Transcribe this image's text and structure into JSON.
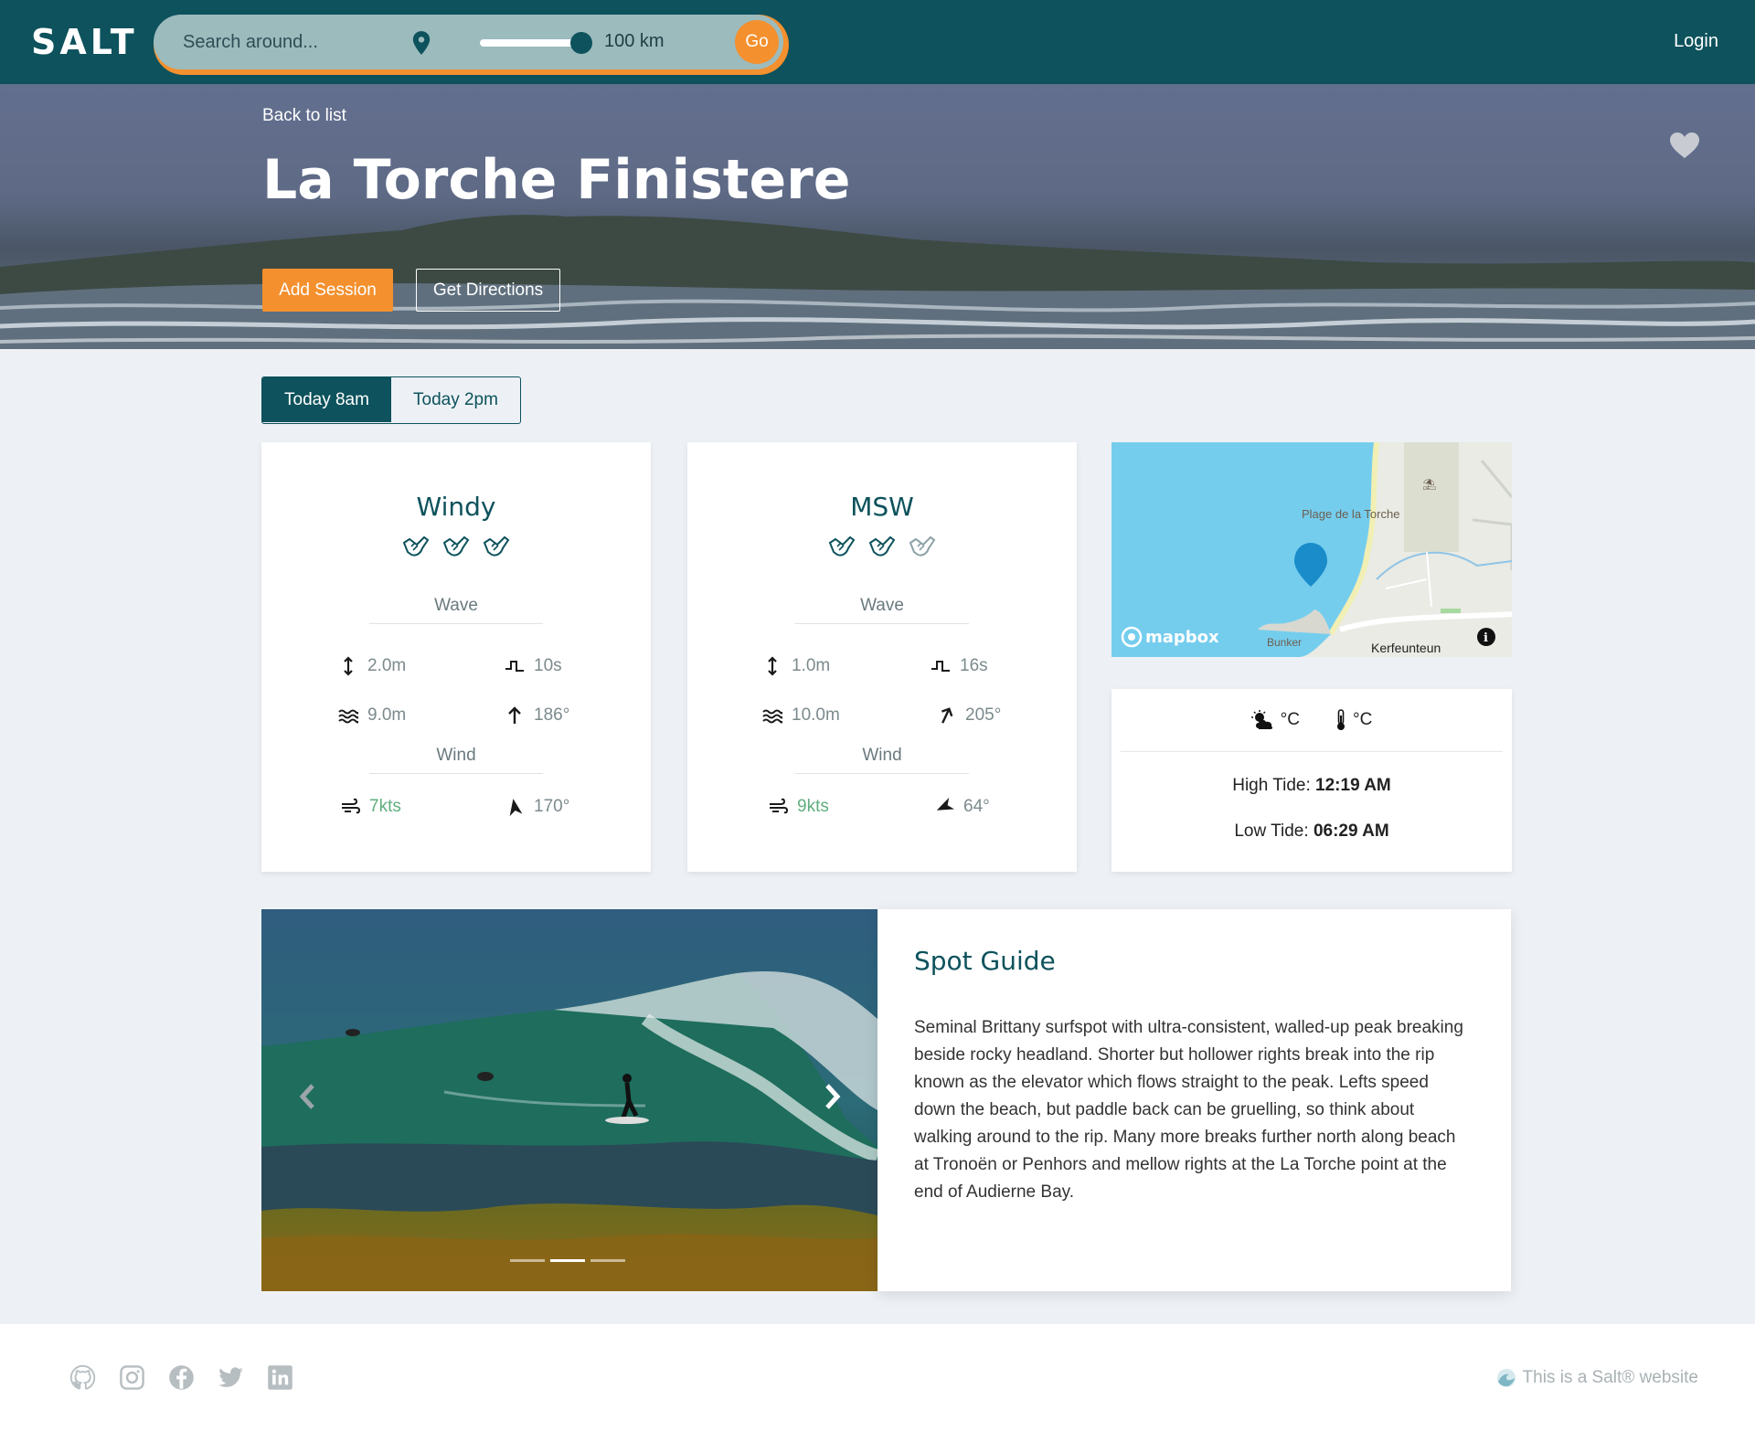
{
  "header": {
    "logo": "SALT",
    "search_placeholder": "Search around...",
    "radius_label": "100 km",
    "radius_value": 100,
    "go_label": "Go",
    "login_label": "Login"
  },
  "hero": {
    "back_label": "Back to list",
    "title": "La Torche Finistere",
    "add_session_label": "Add Session",
    "directions_label": "Get Directions"
  },
  "tabs": [
    {
      "label": "Today 8am",
      "active": true
    },
    {
      "label": "Today 2pm",
      "active": false
    }
  ],
  "forecasts": [
    {
      "source": "Windy",
      "rating": 3,
      "rating_max": 3,
      "wave_label": "Wave",
      "wave_height": "2.0m",
      "wave_period": "10s",
      "swell": "9.0m",
      "wave_direction": "186°",
      "wind_label": "Wind",
      "wind_speed": "7kts",
      "wind_direction": "170°"
    },
    {
      "source": "MSW",
      "rating": 2,
      "rating_max": 3,
      "wave_label": "Wave",
      "wave_height": "1.0m",
      "wave_period": "16s",
      "swell": "10.0m",
      "wave_direction": "205°",
      "wind_label": "Wind",
      "wind_speed": "9kts",
      "wind_direction": "64°"
    }
  ],
  "map": {
    "place_label": "Plage de la Torche",
    "bunker_label": "Bunker",
    "town_label": "Kerfeunteun",
    "brand": "mapbox"
  },
  "weather": {
    "condition_unit": "°C",
    "temp_unit": "°C",
    "high_tide_label": "High Tide:",
    "high_tide_time": "12:19 AM",
    "low_tide_label": "Low Tide:",
    "low_tide_time": "06:29 AM"
  },
  "guide": {
    "title": "Spot Guide",
    "text": "Seminal Brittany surfspot with ultra-consistent, walled-up peak breaking beside rocky headland. Shorter but hollower rights break into the rip known as the elevator which flows straight to the peak. Lefts speed down the beach, but paddle back can be gruelling, so think about walking around to the rip. Many more breaks further north along beach at Tronoën or Penhors and mellow rights at the La Torche point at the end of Audierne Bay."
  },
  "carousel": {
    "slides": 3,
    "active_index": 1
  },
  "footer": {
    "credit": "This is a Salt® website",
    "icons": [
      "github-icon",
      "instagram-icon",
      "facebook-icon",
      "twitter-icon",
      "linkedin-icon"
    ]
  },
  "colors": {
    "primary": "#0d525c",
    "accent": "#f4902e",
    "good": "#5fae7e",
    "background": "#edf1f5"
  }
}
